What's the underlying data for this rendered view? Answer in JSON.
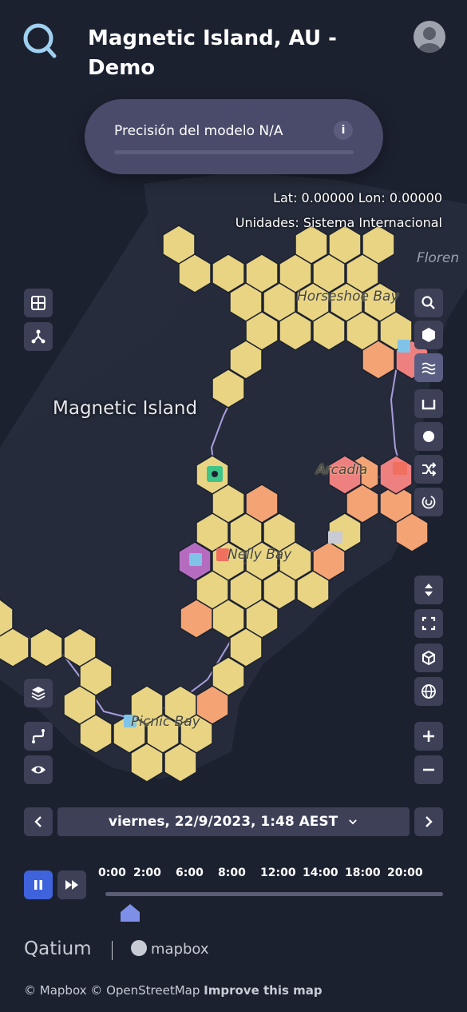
{
  "header": {
    "title": "Magnetic Island, AU - Demo"
  },
  "precision": {
    "label": "Precisión del modelo N/A",
    "info": "i"
  },
  "coords": {
    "latlon": "Lat: 0.00000 Lon: 0.00000",
    "units": "Unidades: Sistema Internacional"
  },
  "map_labels": {
    "island": "Magnetic Island",
    "horseshoe": "Horseshoe Bay",
    "arcadia": "Arcadia",
    "nelly": "Nelly Bay",
    "picnic": "Picnic Bay",
    "florence": "Floren"
  },
  "left_controls": [
    "grid-icon",
    "network-icon"
  ],
  "right_controls": [
    "search-icon",
    "hexagon-icon",
    "waves-icon",
    "tank-icon",
    "circle-icon",
    "shuffle-icon",
    "spiral-icon"
  ],
  "view_controls": [
    "updown-icon",
    "fullscreen-icon",
    "cube-icon",
    "globe-icon",
    "zoom-in-icon",
    "zoom-out-icon"
  ],
  "bottom_left_controls": [
    "layers-icon",
    "route-icon",
    "eye-icon"
  ],
  "date": {
    "label": "viernes, 22/9/2023, 1:48 AEST"
  },
  "timeline": {
    "ticks": [
      "0:00",
      "2:00",
      "6:00",
      "8:00",
      "12:00",
      "14:00",
      "18:00",
      "20:00"
    ],
    "position": 0.074
  },
  "footer": {
    "brand": "Qatium",
    "mapbox": "mapbox",
    "copy": "© Mapbox © OpenStreetMap",
    "improve": "Improve this map"
  },
  "colors": {
    "hex_yellow": "#e8d482",
    "hex_orange": "#f4a474",
    "hex_red": "#ee8080",
    "hex_purple": "#b56cc0",
    "accent": "#3e63dd"
  }
}
